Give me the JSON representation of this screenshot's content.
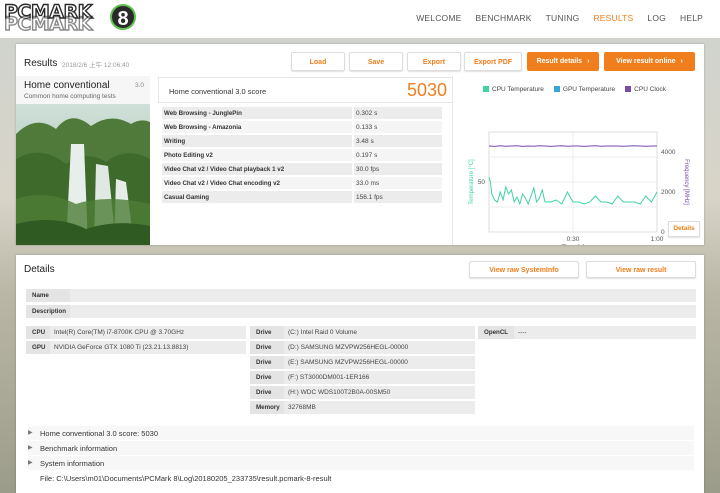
{
  "header": {
    "logo_line1": "PCMARK",
    "logo_line2": "PCMARK",
    "logo_number": "8",
    "nav": [
      "WELCOME",
      "BENCHMARK",
      "TUNING",
      "RESULTS",
      "LOG",
      "HELP"
    ],
    "active_nav": "RESULTS"
  },
  "results": {
    "title": "Results",
    "date": "2018/2/6 上午 12:06:40",
    "buttons": {
      "load": "Load",
      "save": "Save",
      "export": "Export",
      "export_pdf": "Export PDF",
      "result_details": "Result details",
      "view_online": "View result online"
    },
    "test": {
      "name": "Home conventional",
      "version": "3.0",
      "subtitle": "Common home computing tests"
    },
    "score_label": "Home conventional 3.0 score",
    "score_value": "5030",
    "subtests": [
      {
        "name": "Web Browsing - JunglePin",
        "value": "0.302 s"
      },
      {
        "name": "Web Browsing - Amazonia",
        "value": "0.133 s"
      },
      {
        "name": "Writing",
        "value": "3.48 s"
      },
      {
        "name": "Photo Editing v2",
        "value": "0.197 s"
      },
      {
        "name": "Video Chat v2 / Video Chat playback 1 v2",
        "value": "30.0 fps"
      },
      {
        "name": "Video Chat v2 / Video Chat encoding v2",
        "value": "33.0 ms"
      },
      {
        "name": "Casual Gaming",
        "value": "156.1 fps"
      }
    ],
    "details_button": "Details"
  },
  "chart_data": {
    "type": "line",
    "legend": [
      "CPU Temperature",
      "GPU Temperature",
      "CPU Clock"
    ],
    "colors": {
      "cpu_temp": "#3fd3a5",
      "gpu_temp": "#37a5d8",
      "cpu_clock": "#7a4ba8"
    },
    "xlabel": "Time [s]",
    "ylabel_left": "Temperature [°C]",
    "ylabel_right": "Frequency [MHz]",
    "x_ticks": [
      "0:30",
      "1:00"
    ],
    "y_left_ticks": [
      "50"
    ],
    "y_right_ticks": [
      "4000",
      "2000",
      "0"
    ],
    "xlim": [
      0,
      60
    ],
    "y_left_lim": [
      0,
      100
    ],
    "y_right_lim": [
      0,
      5000
    ],
    "series": [
      {
        "name": "CPU Temperature",
        "color": "#3fd3a5",
        "x": [
          0,
          0.5,
          1,
          2,
          3,
          4,
          5,
          6,
          7,
          8,
          9,
          10,
          11,
          12,
          13,
          14,
          15,
          16,
          17,
          18,
          19,
          20,
          22,
          24,
          26,
          28,
          30,
          32,
          34,
          36,
          38,
          40,
          42,
          44,
          46,
          48,
          50,
          52,
          54,
          56,
          58,
          60
        ],
        "y": [
          55,
          50,
          38,
          32,
          30,
          40,
          32,
          45,
          38,
          42,
          30,
          35,
          28,
          38,
          34,
          28,
          36,
          44,
          30,
          34,
          42,
          30,
          30,
          32,
          28,
          40,
          30,
          30,
          28,
          30,
          36,
          30,
          30,
          28,
          36,
          30,
          30,
          30,
          28,
          36,
          30,
          40
        ]
      },
      {
        "name": "CPU Clock",
        "color": "#7a4ba8",
        "x": [
          0,
          2,
          4,
          6,
          8,
          10,
          12,
          14,
          16,
          18,
          20,
          22,
          24,
          26,
          28,
          30,
          32,
          34,
          36,
          38,
          40,
          42,
          44,
          46,
          48,
          50,
          52,
          54,
          56,
          58,
          60
        ],
        "y": [
          4300,
          4280,
          4310,
          4290,
          4300,
          4310,
          4280,
          4300,
          4290,
          4310,
          4300,
          4280,
          4300,
          4310,
          4290,
          4300,
          4300,
          4280,
          4300,
          4310,
          4290,
          4300,
          4300,
          4300,
          4290,
          4300,
          4310,
          4300,
          4290,
          4300,
          4300
        ]
      }
    ]
  },
  "details": {
    "title": "Details",
    "view_systeminfo": "View raw SystemInfo",
    "view_result": "View raw result",
    "name_label": "Name",
    "name_value": "",
    "description_label": "Description",
    "description_value": "",
    "cpu_label": "CPU",
    "cpu_value": "Intel(R) Core(TM) i7-8700K CPU @ 3.70GHz",
    "gpu_label": "GPU",
    "gpu_value": "NVIDIA GeForce GTX 1080 Ti (23.21.13.8813)",
    "drives": [
      {
        "label": "Drive",
        "value": "(C:) Intel Raid 0 Volume"
      },
      {
        "label": "Drive",
        "value": "(D:) SAMSUNG MZVPW256HEGL-00000"
      },
      {
        "label": "Drive",
        "value": "(E:) SAMSUNG MZVPW256HEGL-00000"
      },
      {
        "label": "Drive",
        "value": "(F:) ST3000DM001-1ER166"
      },
      {
        "label": "Drive",
        "value": "(H:) WDC WDS100T2B0A-00SM50"
      },
      {
        "label": "Memory",
        "value": "32768MB"
      }
    ],
    "opencl_label": "OpenCL",
    "opencl_value": "----",
    "expanders": [
      "Home conventional 3.0 score: 5030",
      "Benchmark information",
      "System information"
    ],
    "file_path": "File: C:\\Users\\m01\\Documents\\PCMark 8\\Log\\20180205_233735\\result.pcmark-8-result"
  }
}
